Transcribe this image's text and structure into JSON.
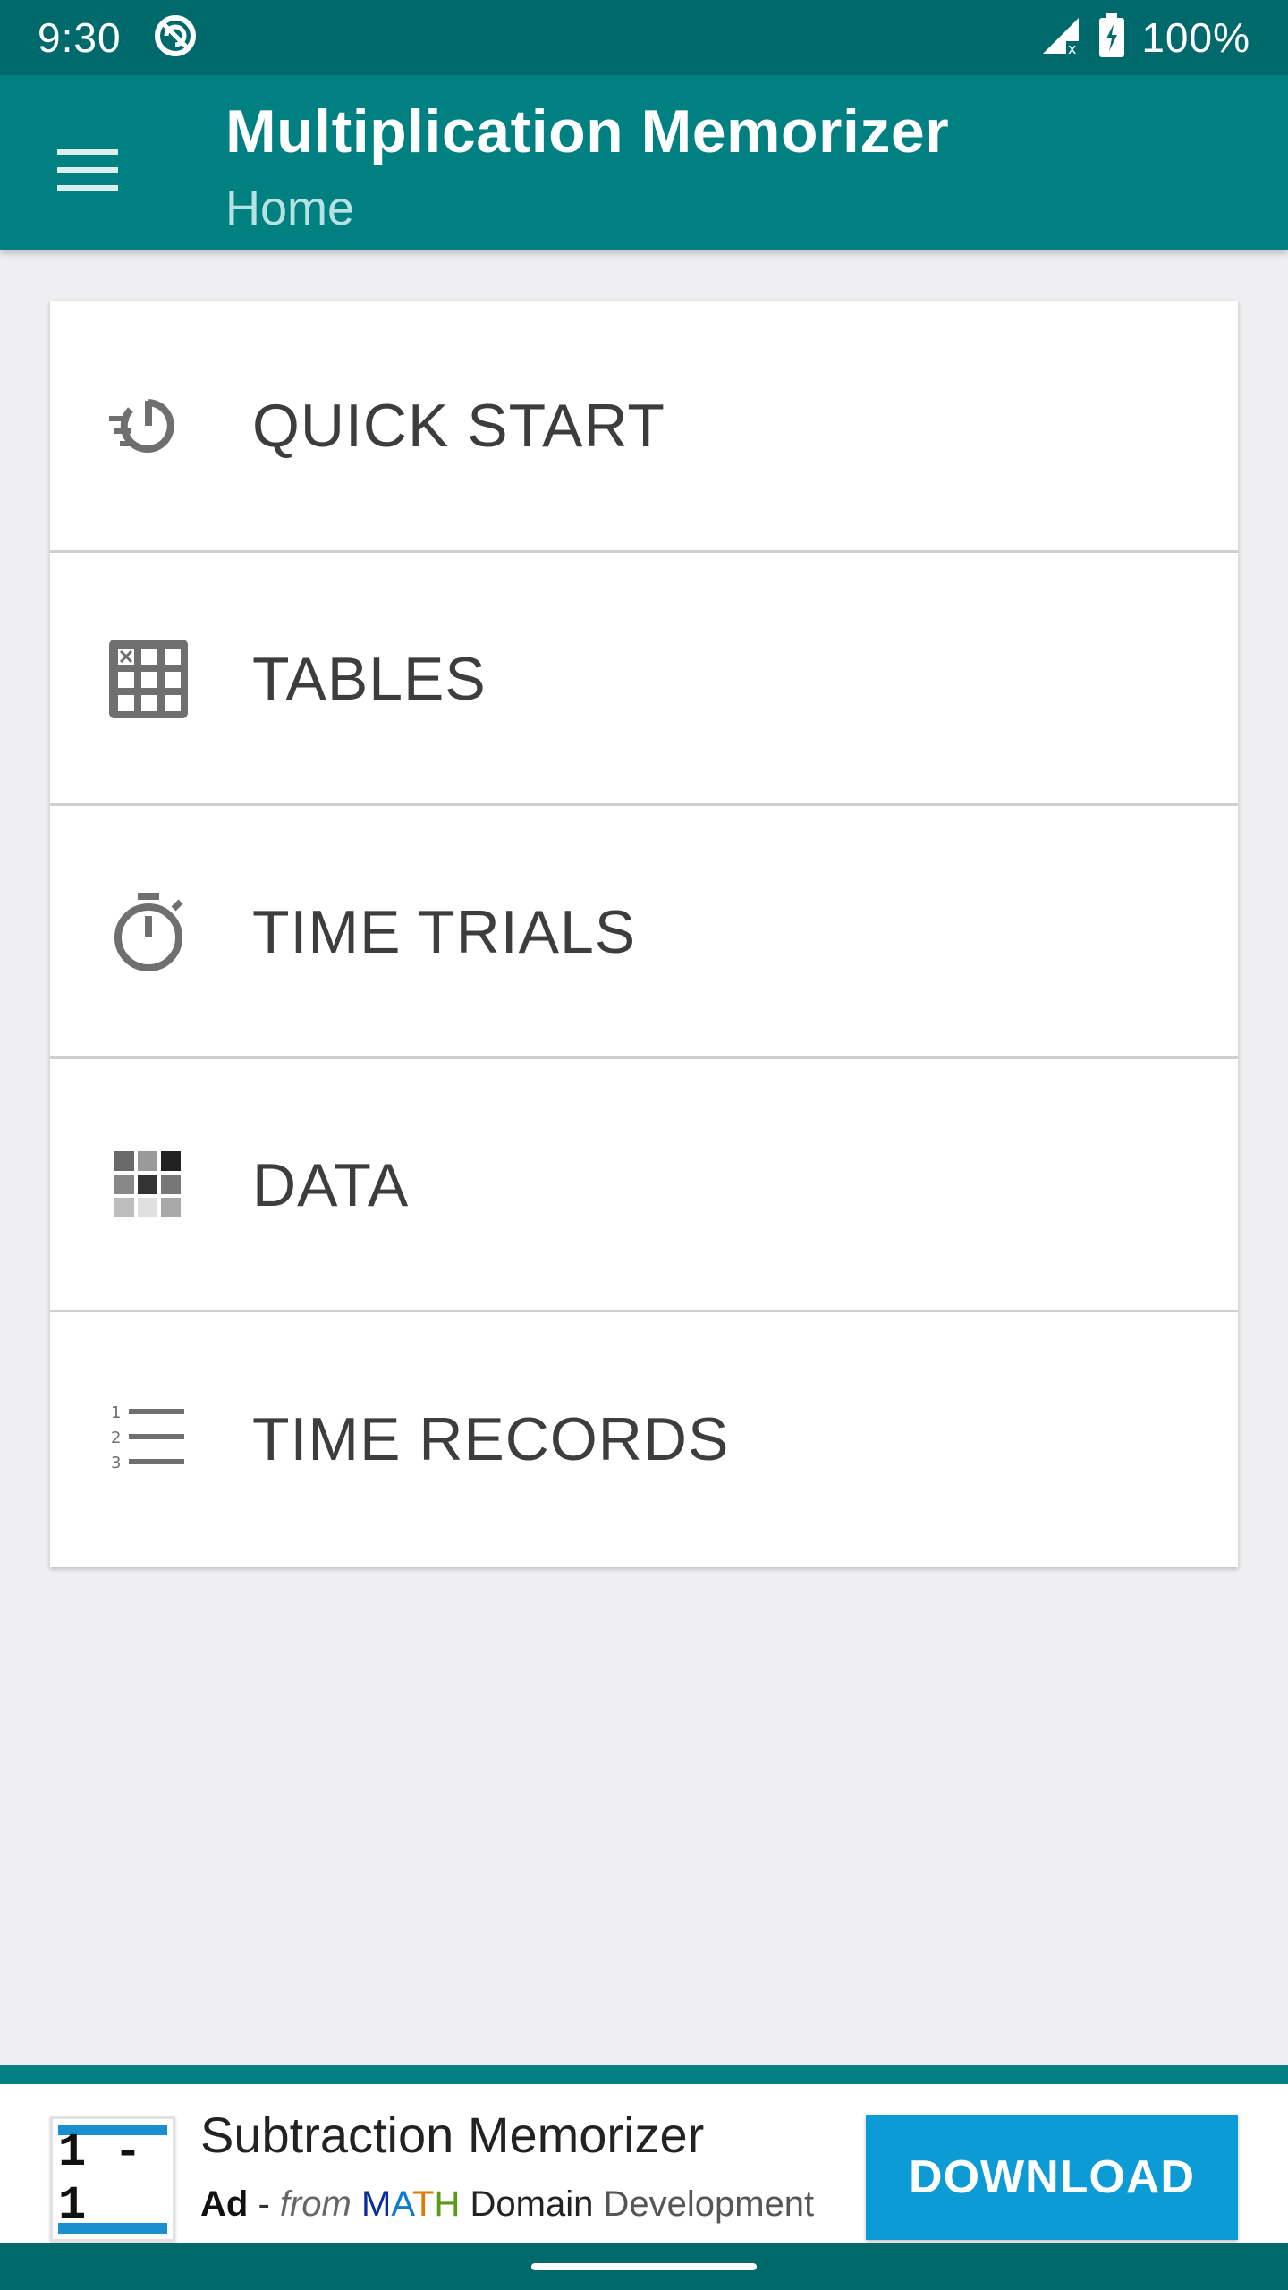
{
  "status_bar": {
    "time": "9:30",
    "battery": "100%",
    "icons": [
      "sync-icon",
      "signal-icon",
      "battery-charging-icon"
    ]
  },
  "app_bar": {
    "title": "Multiplication Memorizer",
    "subtitle": "Home",
    "menu_icon": "hamburger-menu-icon"
  },
  "menu": {
    "items": [
      {
        "label": "QUICK START",
        "icon": "quick-start-icon"
      },
      {
        "label": "TABLES",
        "icon": "tables-grid-icon"
      },
      {
        "label": "TIME TRIALS",
        "icon": "stopwatch-icon"
      },
      {
        "label": "DATA",
        "icon": "data-grid-icon"
      },
      {
        "label": "TIME RECORDS",
        "icon": "numbered-list-icon"
      }
    ]
  },
  "ad": {
    "app_icon_text": "1 - 1",
    "app_name": "Subtraction Memorizer",
    "badge": "Ad",
    "separator": " - ",
    "from": "from",
    "publisher_math": [
      "M",
      "A",
      "T",
      "H"
    ],
    "publisher_domain": "Domain",
    "publisher_dev": "Development",
    "button_label": "DOWNLOAD"
  },
  "colors": {
    "status_bar": "#00696b",
    "app_bar": "#008080",
    "background": "#efeef0",
    "download_button": "#0d9bd6"
  }
}
